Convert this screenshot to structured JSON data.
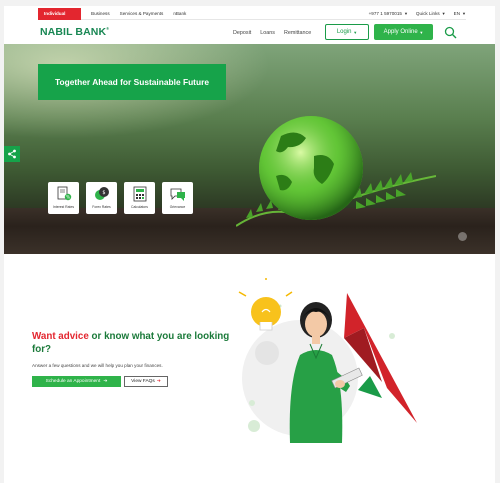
{
  "utility_bar": {
    "segment": "Individual",
    "links": [
      "Business",
      "Services & Payments",
      "nBank"
    ],
    "phone": "+977 1 5970015",
    "quick_links": "Quick Links",
    "language": "EN"
  },
  "header": {
    "logo": "NABIL BANK",
    "nav": [
      "Deposit",
      "Loans",
      "Remittance"
    ],
    "login": "Login",
    "apply": "Apply Online"
  },
  "hero": {
    "title": "Together Ahead for Sustainable Future",
    "tiles": [
      {
        "label": "Interest Rates",
        "icon": "interest-rates-icon"
      },
      {
        "label": "Forex Rates",
        "icon": "forex-rates-icon"
      },
      {
        "label": "Calculators",
        "icon": "calculator-icon"
      },
      {
        "label": "Grievance",
        "icon": "grievance-icon"
      }
    ]
  },
  "advice": {
    "heading_red": "Want advice",
    "heading_green": "or know what you are looking for?",
    "subtext": "Answer a few questions and we will help you plan your finances.",
    "schedule": "Schedule an Appointment",
    "faq": "View FAQs"
  },
  "colors": {
    "brand_green": "#1a9b48",
    "accent_red": "#e3262f",
    "button_green": "#2fb34a"
  }
}
